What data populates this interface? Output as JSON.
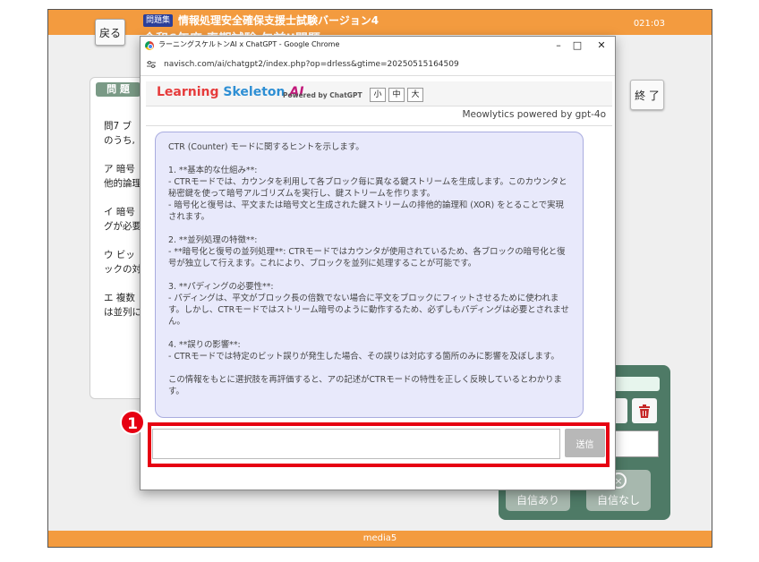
{
  "app": {
    "back_label": "戻る",
    "badge": "問題集",
    "title": "情報処理安全確保支援士試験バージョン4",
    "subtitle": "令和6年度 春期試験 午前II問題",
    "timer": "021:03",
    "end_label": "終 了",
    "footer": "media5"
  },
  "question": {
    "label": "問 題",
    "lines": [
      "問7  ブ",
      "のうち,",
      "ア  暗号",
      "他的論理",
      "イ  暗号",
      "グが必要",
      "ウ  ビッ",
      "ックの対",
      "エ  複数",
      "は並列に"
    ]
  },
  "panel": {
    "confident_label": "自信あり",
    "not_confident_label": "自信なし"
  },
  "popup": {
    "window_title": "ラーニングスケルトンAI x ChatGPT - Google Chrome",
    "url": "navisch.com/ai/chatgpt2/index.php?op=drless&gtime=20250515164509",
    "logo_part1": "Learning",
    "logo_part2": "Skeleton",
    "logo_ai": "AI",
    "powered": "Powered by ChatGPT",
    "size_small": "小",
    "size_medium": "中",
    "size_large": "大",
    "model_note": "Meowlytics powered by gpt-4o",
    "hint_text": "CTR (Counter) モードに関するヒントを示します。\n\n1. **基本的な仕組み**:\n- CTRモードでは、カウンタを利用して各ブロック毎に異なる鍵ストリームを生成します。このカウンタと秘密鍵を使って暗号アルゴリズムを実行し、鍵ストリームを作ります。\n- 暗号化と復号は、平文または暗号文と生成された鍵ストリームの排他的論理和 (XOR) をとることで実現されます。\n\n2. **並列処理の特徴**:\n- **暗号化と復号の並列処理**: CTRモードではカウンタが使用されているため、各ブロックの暗号化と復号が独立して行えます。これにより、ブロックを並列に処理することが可能です。\n\n3. **パディングの必要性**:\n- パディングは、平文がブロック長の倍数でない場合に平文をブロックにフィットさせるために使われます。しかし、CTRモードではストリーム暗号のように動作するため、必ずしもパディングは必要とされません。\n\n4. **誤りの影響**:\n- CTRモードでは特定のビット誤りが発生した場合、その誤りは対応する箇所のみに影響を及ぼします。\n\nこの情報をもとに選択肢を再評価すると、アの記述がCTRモードの特性を正しく反映しているとわかります。",
    "input_value": "",
    "send_label": "送信",
    "callout_number": "1"
  },
  "colors": {
    "header_orange": "#f39b3f",
    "panel_green": "#4e7a66",
    "callout_red": "#e60012",
    "bubble_bg": "#e8e9fb"
  }
}
